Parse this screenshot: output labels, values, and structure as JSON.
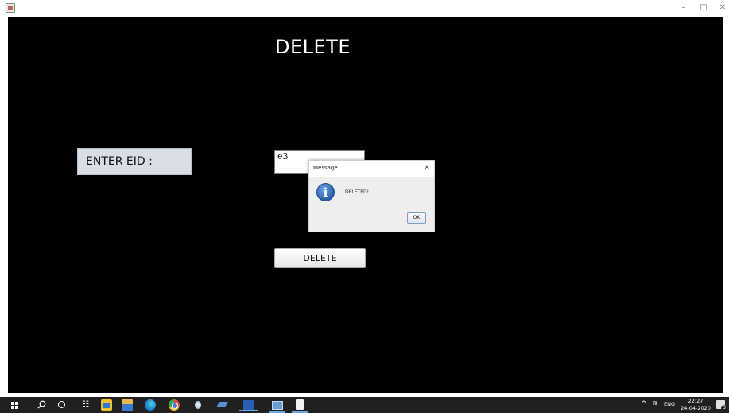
{
  "window": {
    "minimize_glyph": "–",
    "maximize_glyph": "□",
    "close_glyph": "✕"
  },
  "app": {
    "title": "DELETE",
    "eid_label": "ENTER EID :",
    "eid_value": "e3",
    "delete_button_label": "DELETE"
  },
  "dialog": {
    "title": "Message",
    "message": "DELETED!",
    "ok_label": "OK",
    "close_glyph": "✕",
    "icon_glyph": "i"
  },
  "taskbar": {
    "icons": [
      "windows-start-icon",
      "search-icon",
      "cortana-icon",
      "task-view-icon",
      "store-icon",
      "file-explorer-icon",
      "edge-icon",
      "chrome-icon",
      "app-icon",
      "pen-icon",
      "word-icon",
      "monitor-icon",
      "java-icon"
    ],
    "tray_chevron": "^",
    "wifi_glyph": "⩎",
    "language": "ENG",
    "time": "22:27",
    "date": "24-04-2020",
    "notification_count": "3"
  }
}
